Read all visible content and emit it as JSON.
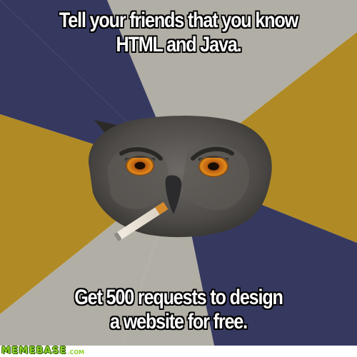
{
  "meme": {
    "top_text": [
      "Tell your friends that you know",
      "HTML and Java."
    ],
    "bottom_text": [
      "Get 500 requests to design",
      "a website for free."
    ],
    "subject": "owl-with-cigarette",
    "background_colors": {
      "navy": "#36395f",
      "gray": "#b1aea5",
      "gold": "#b08a25"
    }
  },
  "footer": {
    "brand": "MEMEBASE",
    "brand_suffix": ".COM",
    "brand_color": "#8ccf2a"
  }
}
